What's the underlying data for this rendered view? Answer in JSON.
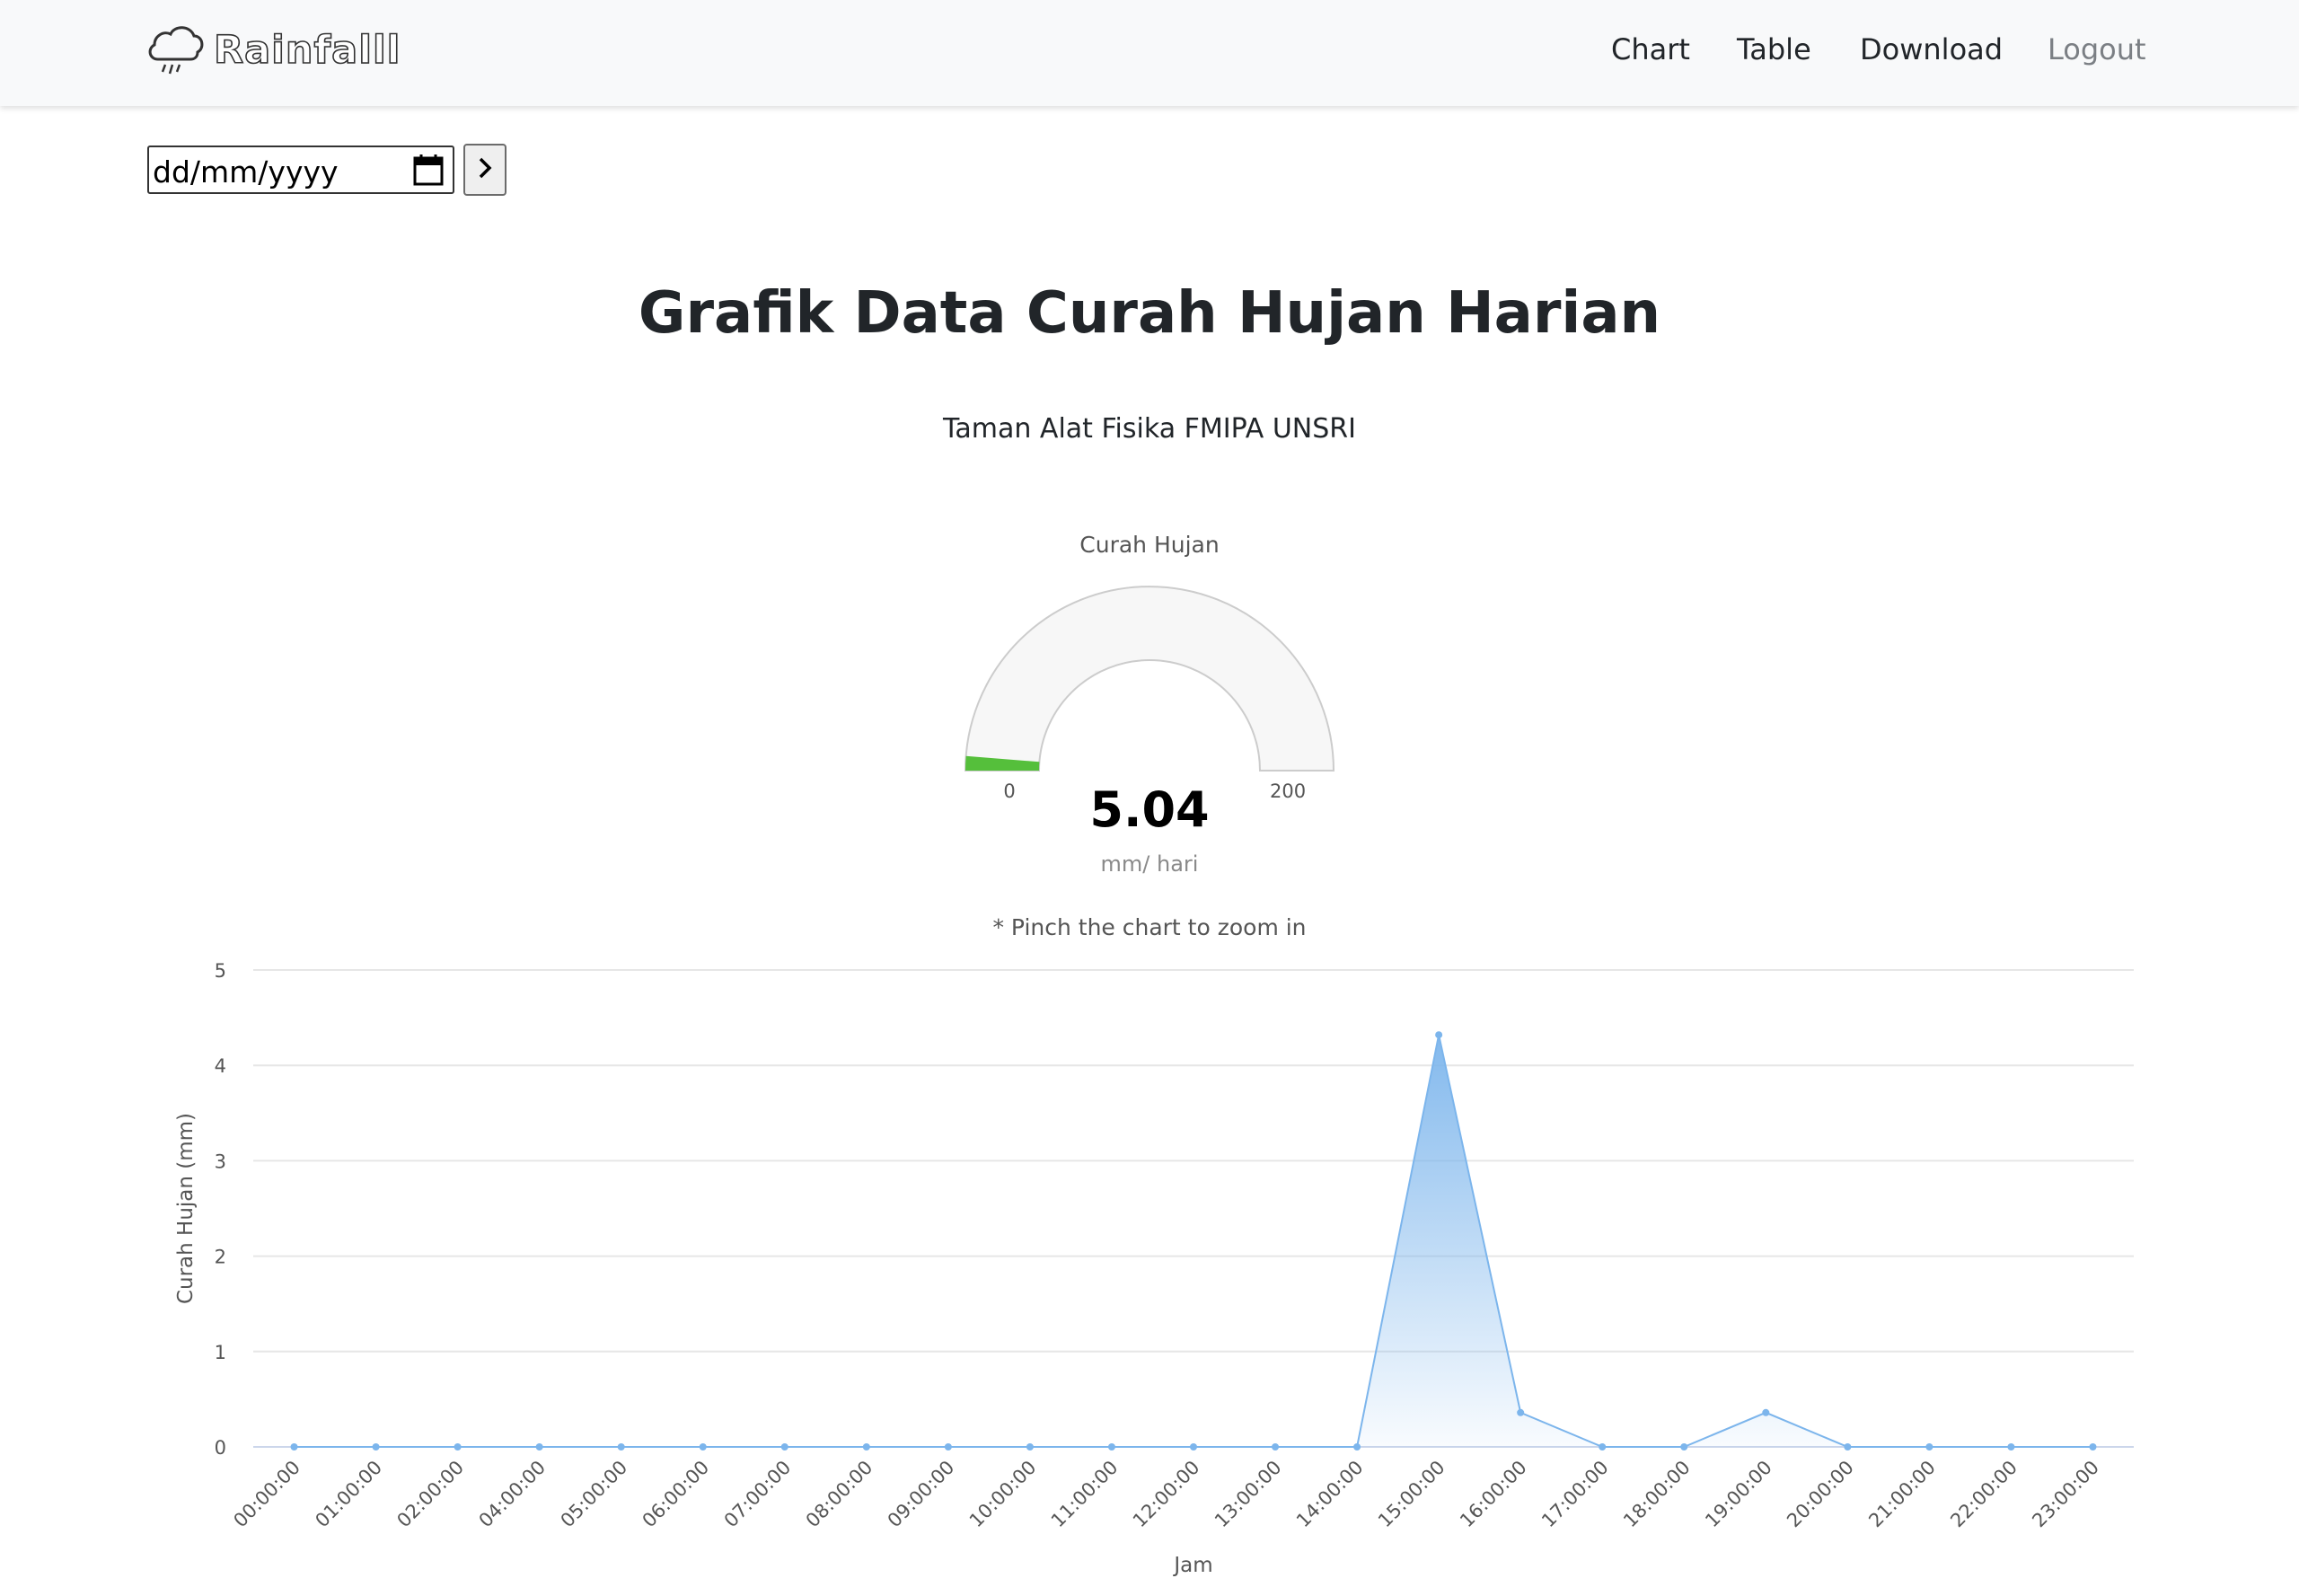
{
  "navbar": {
    "brand": "Rainfalll",
    "links": [
      {
        "label": "Chart"
      },
      {
        "label": "Table"
      },
      {
        "label": "Download"
      },
      {
        "label": "Logout"
      }
    ]
  },
  "date_picker": {
    "placeholder": "dd/mm/yyyy",
    "submit_glyph": "›"
  },
  "page": {
    "title": "Grafik Data Curah Hujan Harian",
    "subtitle": "Taman Alat Fisika FMIPA UNSRI"
  },
  "gauge": {
    "title": "Curah Hujan",
    "min": "0",
    "max": "200",
    "value": 5.04,
    "value_label": "5.04",
    "unit": "mm/ hari",
    "color": "#55bf3b"
  },
  "note": "* Pinch the chart to zoom in",
  "chart_data": {
    "type": "area",
    "title": "",
    "xlabel": "Jam",
    "ylabel": "Curah Hujan (mm)",
    "ylim": [
      0,
      5
    ],
    "yticks": [
      "0",
      "1",
      "2",
      "3",
      "4",
      "5"
    ],
    "grid": true,
    "categories": [
      "00:00:00",
      "01:00:00",
      "02:00:00",
      "04:00:00",
      "05:00:00",
      "06:00:00",
      "07:00:00",
      "08:00:00",
      "09:00:00",
      "10:00:00",
      "11:00:00",
      "12:00:00",
      "13:00:00",
      "14:00:00",
      "15:00:00",
      "16:00:00",
      "17:00:00",
      "18:00:00",
      "19:00:00",
      "20:00:00",
      "21:00:00",
      "22:00:00",
      "23:00:00"
    ],
    "series": [
      {
        "values": [
          0,
          0,
          0,
          0,
          0,
          0,
          0,
          0,
          0,
          0,
          0,
          0,
          0,
          0,
          4.32,
          0.36,
          0,
          0,
          0.36,
          0,
          0,
          0,
          0
        ]
      }
    ],
    "color": "#7cb5ec"
  }
}
